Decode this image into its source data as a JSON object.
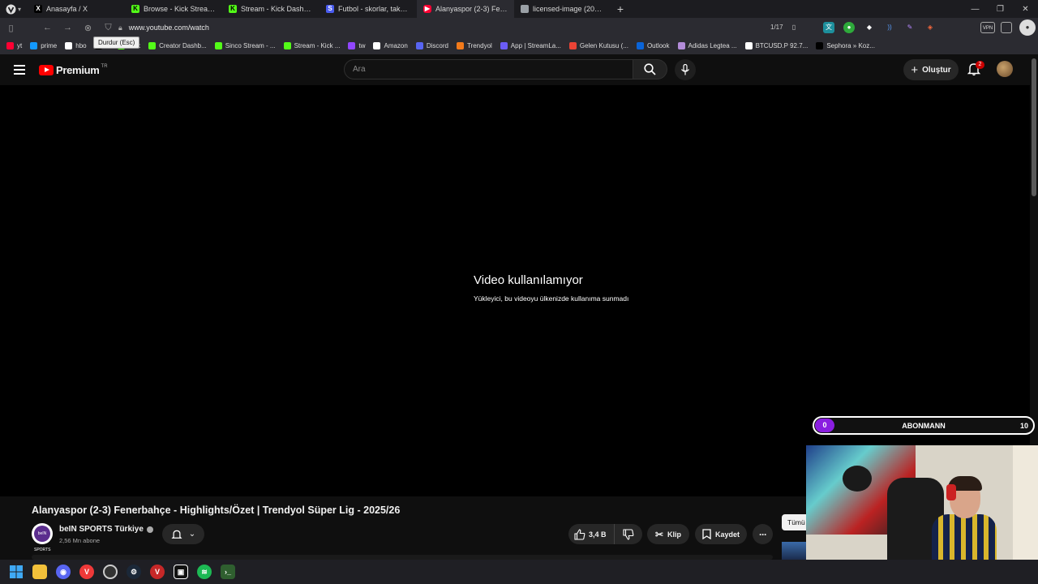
{
  "browser": {
    "tabs": [
      {
        "label": "Anasayfa / X",
        "icon": "x-icon",
        "color": "#000000"
      },
      {
        "label": "Browse - Kick Streaming",
        "icon": "kick-icon",
        "color": "#53fc18"
      },
      {
        "label": "Stream - Kick Dashboard",
        "icon": "kick-icon",
        "color": "#53fc18"
      },
      {
        "label": "Futbol - skorlar, takvim & c",
        "icon": "flashscore-icon",
        "color": "#4a5cf0"
      },
      {
        "label": "Alanyaspor (2-3) Fenerbahç",
        "icon": "youtube-icon",
        "color": "#ff0033"
      },
      {
        "label": "licensed-image (2048×136",
        "icon": "image-icon",
        "color": "#9aa0a6"
      }
    ],
    "url": "www.youtube.com/watch",
    "page_counter": "1/17",
    "tooltip": "Durdur (Esc)",
    "vpn_label": "VPN",
    "bookmarks": [
      {
        "label": "yt",
        "color": "#ff0033"
      },
      {
        "label": "prime",
        "color": "#1399ff"
      },
      {
        "label": "hbo",
        "color": "#ffffff"
      },
      {
        "label": "X",
        "color": "#000000"
      },
      {
        "label": "Kick",
        "color": "#53fc18"
      },
      {
        "label": "Creator Dashb...",
        "color": "#53fc18"
      },
      {
        "label": "Sinco Stream - ...",
        "color": "#53fc18"
      },
      {
        "label": "Stream - Kick ...",
        "color": "#53fc18"
      },
      {
        "label": "tw",
        "color": "#9146ff"
      },
      {
        "label": "Amazon",
        "color": "#ffffff"
      },
      {
        "label": "Discord",
        "color": "#5865f2"
      },
      {
        "label": "Trendyol",
        "color": "#f27a1a"
      },
      {
        "label": "App | StreamLa...",
        "color": "#6b5cf6"
      },
      {
        "label": "Gelen Kutusu (...",
        "color": "#ea4335"
      },
      {
        "label": "Outlook",
        "color": "#0a64d8"
      },
      {
        "label": "Adidas Legtea ...",
        "color": "#b38cd9"
      },
      {
        "label": "BTCUSD.P 92.7...",
        "color": "#ffffff"
      },
      {
        "label": "Sephora » Koz...",
        "color": "#000000"
      }
    ]
  },
  "youtube": {
    "logo_text": "Premium",
    "country_code": "TR",
    "search_placeholder": "Ara",
    "create_label": "Oluştur",
    "notification_count": "2",
    "player": {
      "message_title": "Video kullanılamıyor",
      "message_subtitle": "Yükleyici, bu videoyu ülkenizde kullanıma sunmadı"
    },
    "video": {
      "title": "Alanyaspor (2-3) Fenerbahçe - Highlights/Özet | Trendyol Süper Lig - 2025/26",
      "channel": "beIN SPORTS Türkiye",
      "channel_avatar_text": "beIN SPORTS",
      "subscribers": "2,56 Mn abone",
      "likes": "3,4 B",
      "clip_label": "Klip",
      "save_label": "Kaydet"
    },
    "chip_all": "Tümü"
  },
  "overlay": {
    "sub_goal_label": "ABONMANN",
    "sub_goal_current": "0",
    "sub_goal_target": "10"
  },
  "taskbar": {
    "apps": [
      "windows-start-icon",
      "file-explorer-icon",
      "discord-icon",
      "vivaldi-icon",
      "obs-icon",
      "steam-icon",
      "vivaldi-red-icon",
      "capcut-icon",
      "spotify-icon",
      "terminal-icon"
    ]
  }
}
